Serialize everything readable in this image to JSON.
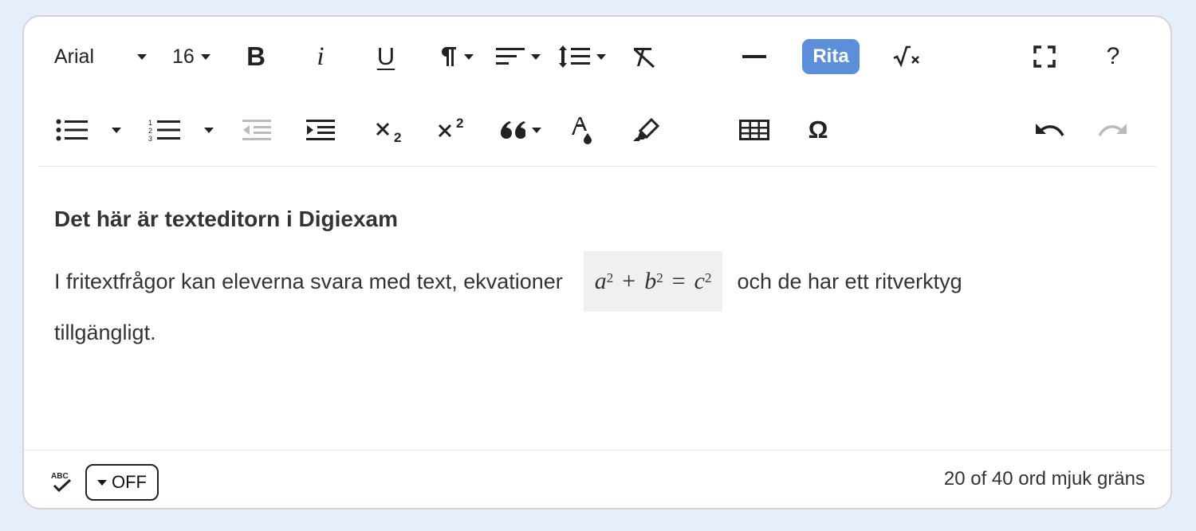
{
  "toolbar": {
    "font_family": "Arial",
    "font_size": "16",
    "bold_label": "B",
    "italic_label": "i",
    "underline_label": "U",
    "draw_label": "Rita",
    "help_label": "?",
    "special_char_label": "Ω",
    "icons": [
      "caret-down-icon",
      "bold-icon",
      "italic-icon",
      "underline-icon",
      "paragraph-format-icon",
      "align-icon",
      "line-height-icon",
      "clear-format-icon",
      "horizontal-line-icon",
      "math-icon",
      "fullscreen-icon",
      "help-icon",
      "bullet-list-icon",
      "numbered-list-icon",
      "outdent-icon",
      "indent-icon",
      "subscript-icon",
      "superscript-icon",
      "quote-icon",
      "text-color-icon",
      "highlight-icon",
      "table-icon",
      "omega-icon",
      "undo-icon",
      "redo-icon"
    ]
  },
  "content": {
    "heading": "Det här är texteditorn i Digiexam",
    "paragraph_before": "I fritextfrågor kan eleverna svara med text, ekvationer",
    "equation": {
      "a": "a",
      "b": "b",
      "c": "c",
      "exp": "2",
      "plus": "+",
      "equals": "="
    },
    "paragraph_after": "och de har ett ritverktyg",
    "paragraph_end": "tillgängligt."
  },
  "footer": {
    "spellcheck_icon_label": "ABC",
    "toggle_label": "OFF",
    "word_count": "20 of 40 ord mjuk gräns"
  },
  "colors": {
    "accent": "#5b8fd9",
    "page_background": "#e6eefb",
    "disabled_icon": "#bbbbbb"
  }
}
